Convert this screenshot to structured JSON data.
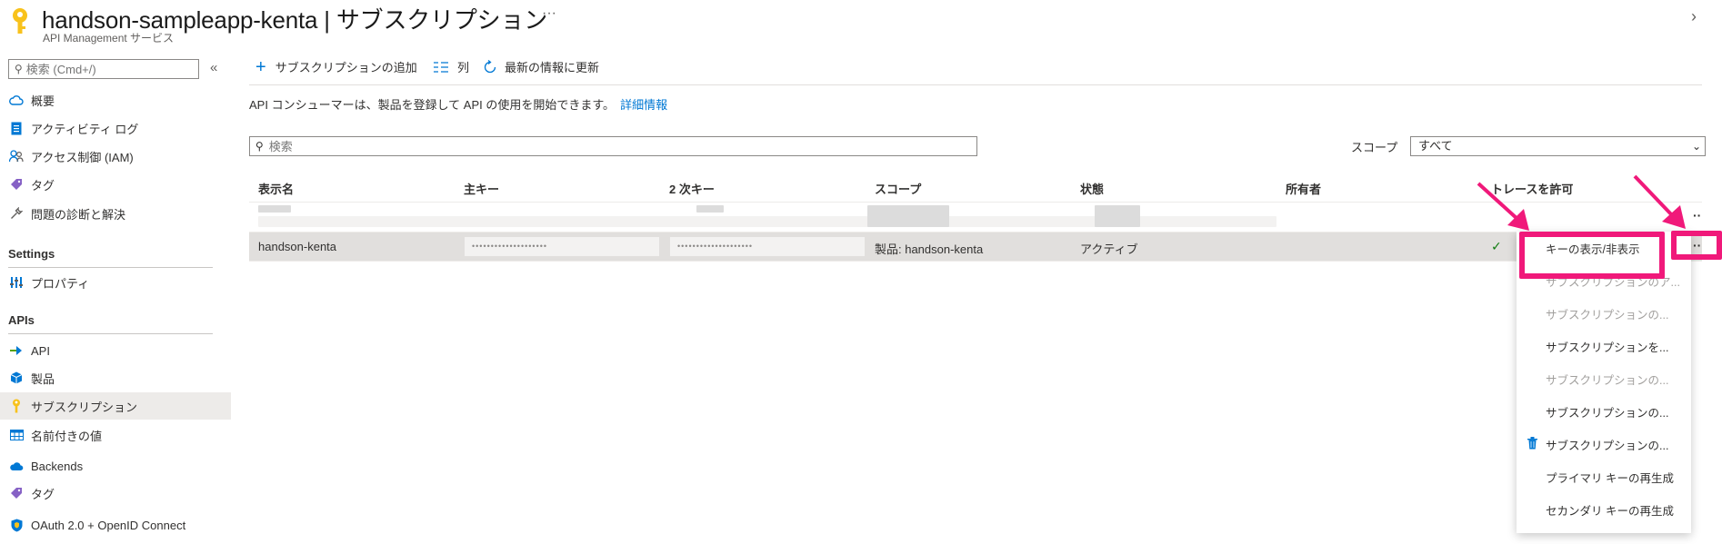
{
  "header": {
    "title": "handson-sampleapp-kenta | サブスクリプション",
    "subtitle": "API Management サービス",
    "more": "···",
    "chevron": "›"
  },
  "sidebar": {
    "search_placeholder": "検索 (Cmd+/)",
    "collapse": "«",
    "items": [
      {
        "label": "概要",
        "icon": "cloud-icon"
      },
      {
        "label": "アクティビティ ログ",
        "icon": "activity-log-icon"
      },
      {
        "label": "アクセス制御 (IAM)",
        "icon": "people-icon"
      },
      {
        "label": "タグ",
        "icon": "tag-icon"
      },
      {
        "label": "問題の診断と解決",
        "icon": "wrench-icon"
      }
    ],
    "settings_header": "Settings",
    "settings_items": [
      {
        "label": "プロパティ",
        "icon": "properties-icon"
      }
    ],
    "apis_header": "APIs",
    "apis_items": [
      {
        "label": "API",
        "icon": "api-icon"
      },
      {
        "label": "製品",
        "icon": "product-icon"
      },
      {
        "label": "サブスクリプション",
        "icon": "key-icon",
        "active": true
      },
      {
        "label": "名前付きの値",
        "icon": "table-icon"
      },
      {
        "label": "Backends",
        "icon": "cloud-backend-icon"
      },
      {
        "label": "タグ",
        "icon": "tag-icon"
      },
      {
        "label": "OAuth 2.0 + OpenID Connect",
        "icon": "shield-icon"
      }
    ]
  },
  "toolbar": {
    "add_label": "サブスクリプションの追加",
    "columns_label": "列",
    "refresh_label": "最新の情報に更新"
  },
  "description": {
    "text": "API コンシューマーは、製品を登録して API の使用を開始できます。",
    "link": "詳細情報"
  },
  "filter": {
    "search_placeholder": "検索",
    "scope_label": "スコープ",
    "scope_value": "すべて"
  },
  "table": {
    "columns": [
      "表示名",
      "主キー",
      "2 次キー",
      "スコープ",
      "状態",
      "所有者",
      "トレースを許可"
    ],
    "selected_row": {
      "name": "handson-kenta",
      "primary_key": "••••••••••••••••••••",
      "secondary_key": "••••••••••••••••••••",
      "scope": "製品: handson-kenta",
      "state": "アクティブ",
      "owner": "",
      "trace": "✓"
    },
    "row_more": "··"
  },
  "context_menu": {
    "items": [
      {
        "label": "キーの表示/非表示",
        "disabled": false
      },
      {
        "label": "サブスクリプションのア...",
        "disabled": true
      },
      {
        "label": "サブスクリプションの...",
        "disabled": true
      },
      {
        "label": "サブスクリプションを...",
        "disabled": false
      },
      {
        "label": "サブスクリプションの...",
        "disabled": true
      },
      {
        "label": "サブスクリプションの...",
        "disabled": false
      },
      {
        "label": "サブスクリプションの...",
        "disabled": false,
        "icon": "trash-icon"
      },
      {
        "label": "プライマリ キーの再生成",
        "disabled": false
      },
      {
        "label": "セカンダリ キーの再生成",
        "disabled": false
      }
    ]
  },
  "colors": {
    "accent": "#0078d4",
    "highlight": "#f0197a",
    "key_yellow": "#f8c21c",
    "check_green": "#107c10"
  }
}
